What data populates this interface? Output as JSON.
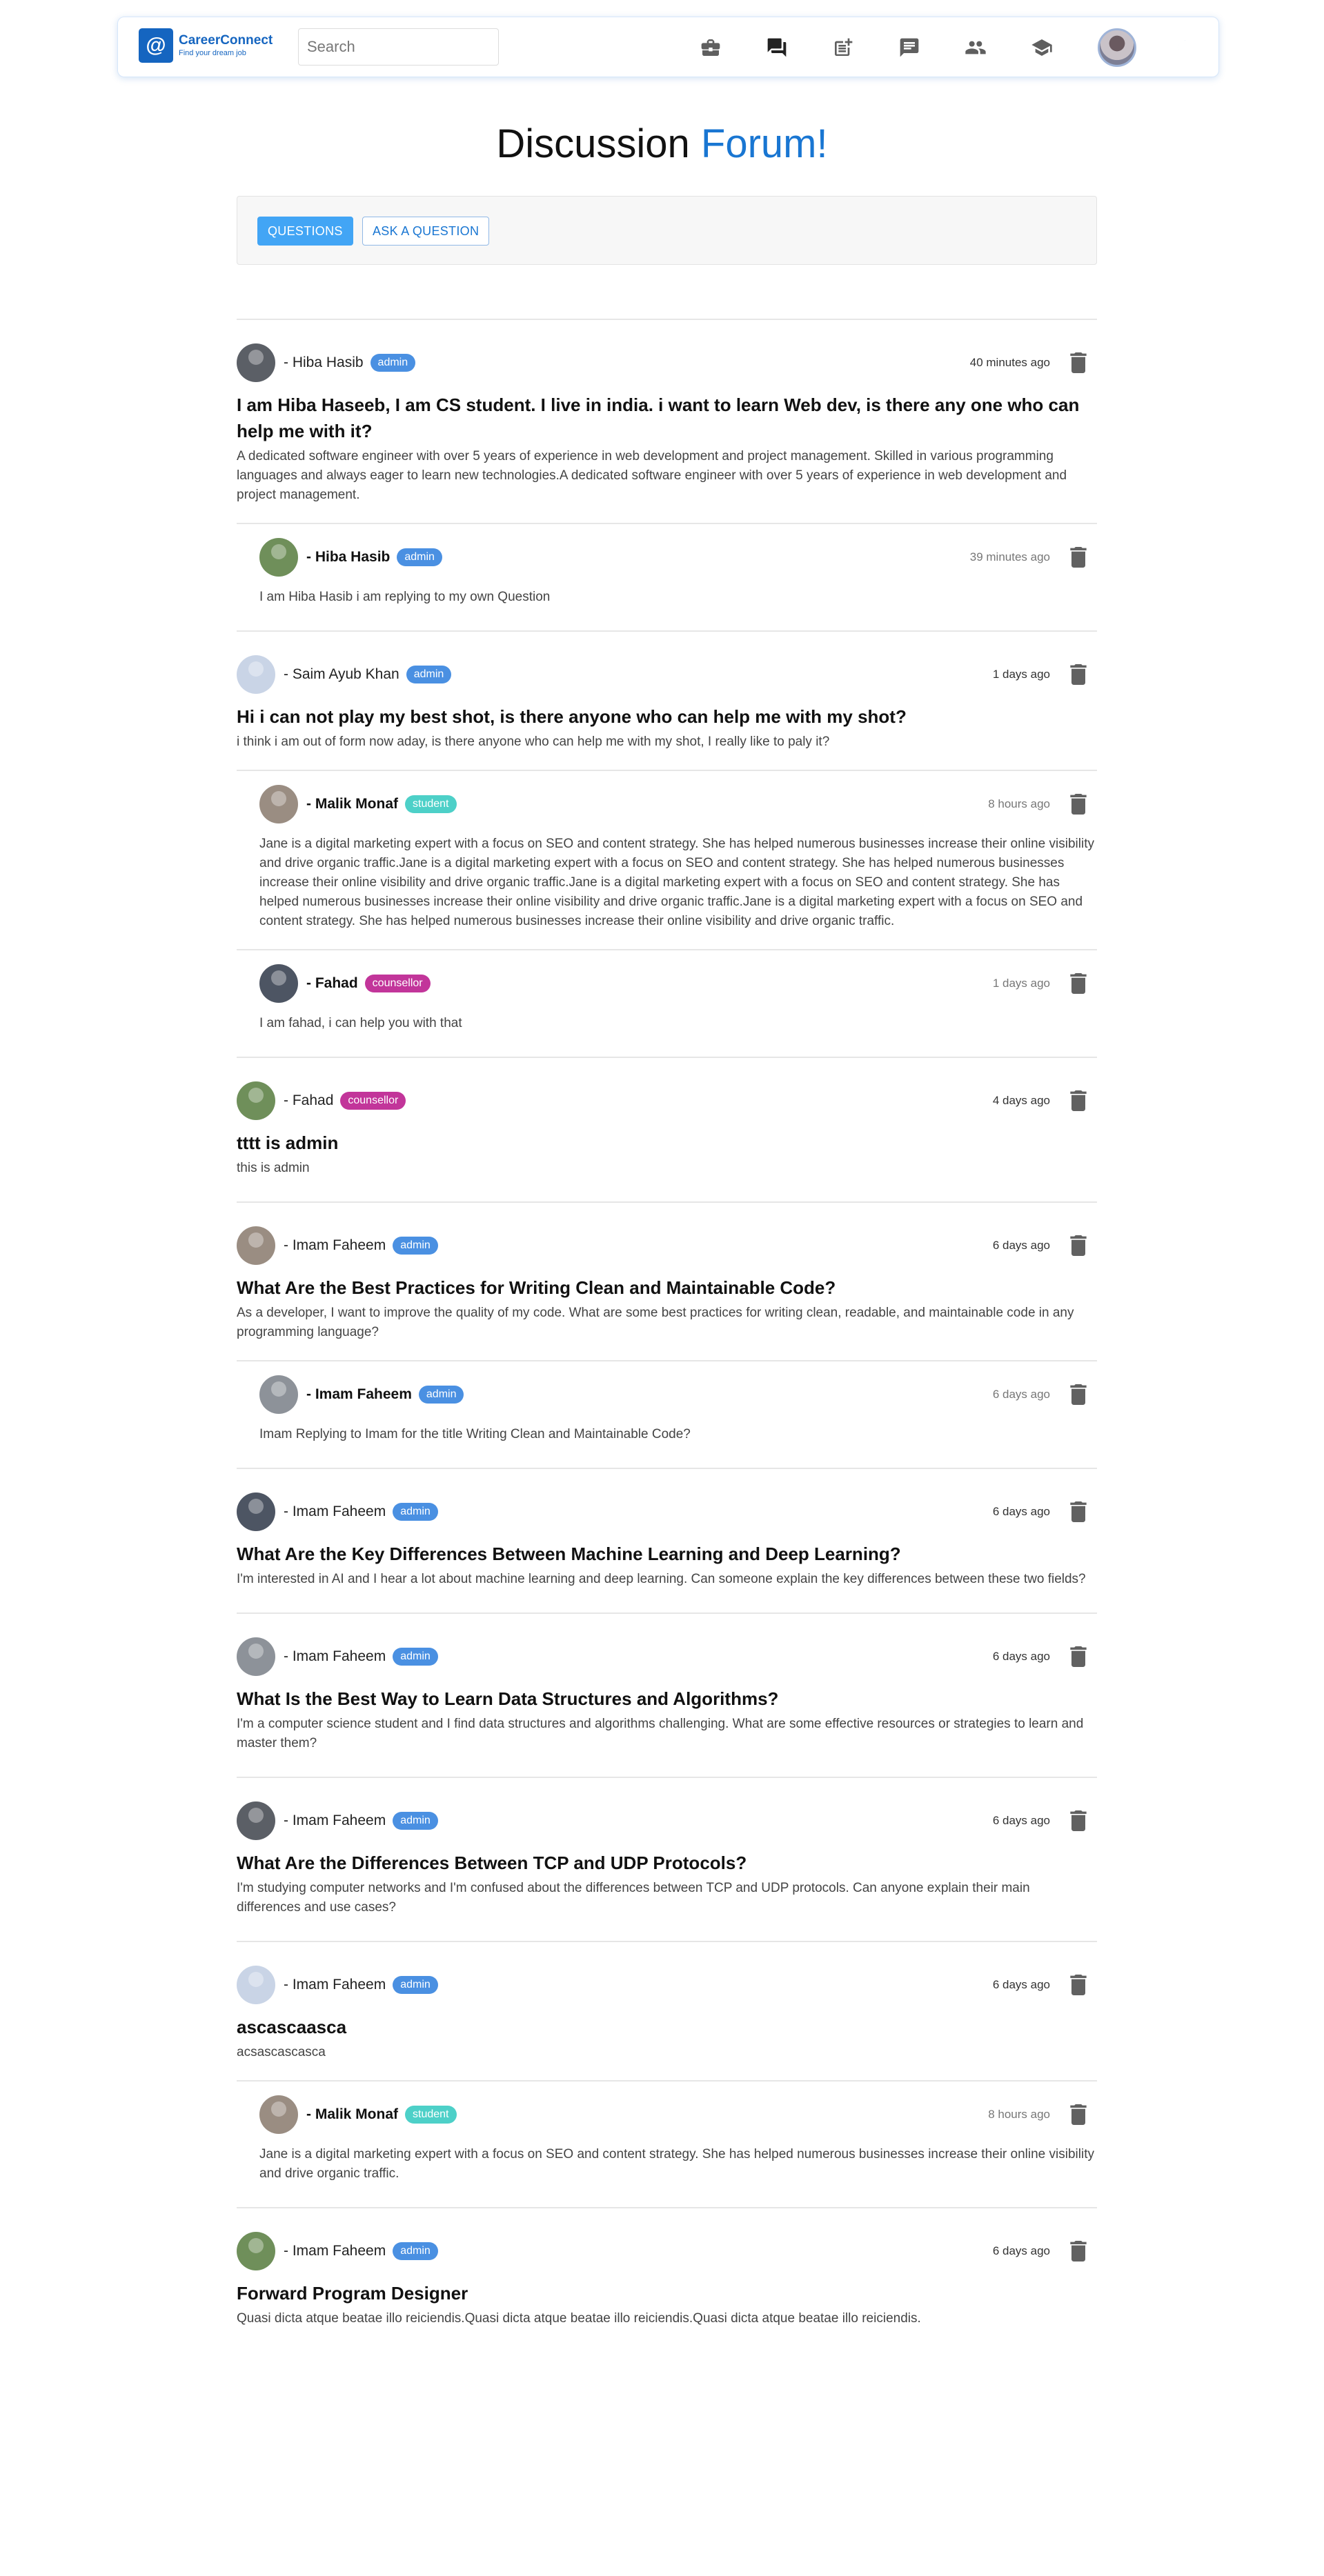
{
  "header": {
    "logo_symbol": "@",
    "logo_name": "CareerConnect",
    "logo_tagline": "Find your dream job",
    "search_placeholder": "Search",
    "nav_icons": [
      "briefcase-icon",
      "forum-icon",
      "post-add-icon",
      "chat-icon",
      "people-icon",
      "school-icon"
    ],
    "theme_icon": "moon-icon"
  },
  "page": {
    "title_main": "Discussion ",
    "title_accent": "Forum!"
  },
  "tabs": {
    "questions": "QUESTIONS",
    "ask": "ASK A QUESTION"
  },
  "colors": {
    "brand": "#1565c0",
    "accent": "#1976d2",
    "admin_badge": "#4a90e2",
    "student_badge": "#4dd0c8",
    "counsellor_badge": "#c2359a"
  },
  "questions": [
    {
      "author": "- Hiba Hasib",
      "role": "admin",
      "time": "40 minutes ago",
      "title": "I am Hiba Haseeb, I am CS student. I live in india. i want to learn Web dev, is there any one who can help me with it?",
      "body": "A dedicated software engineer with over 5 years of experience in web development and project management. Skilled in various programming languages and always eager to learn new technologies.A dedicated software engineer with over 5 years of experience in web development and project management.",
      "replies": [
        {
          "author": "- Hiba Hasib",
          "role": "admin",
          "time": "39 minutes ago",
          "body": "I am Hiba Hasib i am replying to my own Question"
        }
      ]
    },
    {
      "author": "- Saim Ayub Khan",
      "role": "admin",
      "time": "1 days ago",
      "title": "Hi i can not play my best shot, is there anyone who can help me with my shot?",
      "body": "i think i am out of form now aday, is there anyone who can help me with my shot, I really like to paly it?",
      "replies": [
        {
          "author": "- Malik Monaf",
          "role": "student",
          "time": "8 hours ago",
          "body": "Jane is a digital marketing expert with a focus on SEO and content strategy. She has helped numerous businesses increase their online visibility and drive organic traffic.Jane is a digital marketing expert with a focus on SEO and content strategy. She has helped numerous businesses increase their online visibility and drive organic traffic.Jane is a digital marketing expert with a focus on SEO and content strategy. She has helped numerous businesses increase their online visibility and drive organic traffic.Jane is a digital marketing expert with a focus on SEO and content strategy. She has helped numerous businesses increase their online visibility and drive organic traffic."
        },
        {
          "author": "- Fahad",
          "role": "counsellor",
          "time": "1 days ago",
          "body": "I am fahad, i can help you with that"
        }
      ]
    },
    {
      "author": "- Fahad",
      "role": "counsellor",
      "time": "4 days ago",
      "title": "tttt is admin",
      "body": "this is admin",
      "replies": []
    },
    {
      "author": "- Imam Faheem",
      "role": "admin",
      "time": "6 days ago",
      "title": "What Are the Best Practices for Writing Clean and Maintainable Code?",
      "body": "As a developer, I want to improve the quality of my code. What are some best practices for writing clean, readable, and maintainable code in any programming language?",
      "replies": [
        {
          "author": "- Imam Faheem",
          "role": "admin",
          "time": "6 days ago",
          "body": "Imam Replying to Imam for the title Writing Clean and Maintainable Code?"
        }
      ]
    },
    {
      "author": "- Imam Faheem",
      "role": "admin",
      "time": "6 days ago",
      "title": "What Are the Key Differences Between Machine Learning and Deep Learning?",
      "body": "I'm interested in AI and I hear a lot about machine learning and deep learning. Can someone explain the key differences between these two fields?",
      "replies": []
    },
    {
      "author": "- Imam Faheem",
      "role": "admin",
      "time": "6 days ago",
      "title": "What Is the Best Way to Learn Data Structures and Algorithms?",
      "body": "I'm a computer science student and I find data structures and algorithms challenging. What are some effective resources or strategies to learn and master them?",
      "replies": []
    },
    {
      "author": "- Imam Faheem",
      "role": "admin",
      "time": "6 days ago",
      "title": "What Are the Differences Between TCP and UDP Protocols?",
      "body": "I'm studying computer networks and I'm confused about the differences between TCP and UDP protocols. Can anyone explain their main differences and use cases?",
      "replies": []
    },
    {
      "author": "- Imam Faheem",
      "role": "admin",
      "time": "6 days ago",
      "title": "ascascaasca",
      "body": "acsascascasca",
      "replies": [
        {
          "author": "- Malik Monaf",
          "role": "student",
          "time": "8 hours ago",
          "body": "Jane is a digital marketing expert with a focus on SEO and content strategy. She has helped numerous businesses increase their online visibility and drive organic traffic."
        }
      ]
    },
    {
      "author": "- Imam Faheem",
      "role": "admin",
      "time": "6 days ago",
      "title": "Forward Program Designer",
      "body": "Quasi dicta atque beatae illo reiciendis.Quasi dicta atque beatae illo reiciendis.Quasi dicta atque beatae illo reiciendis.",
      "replies": []
    }
  ]
}
